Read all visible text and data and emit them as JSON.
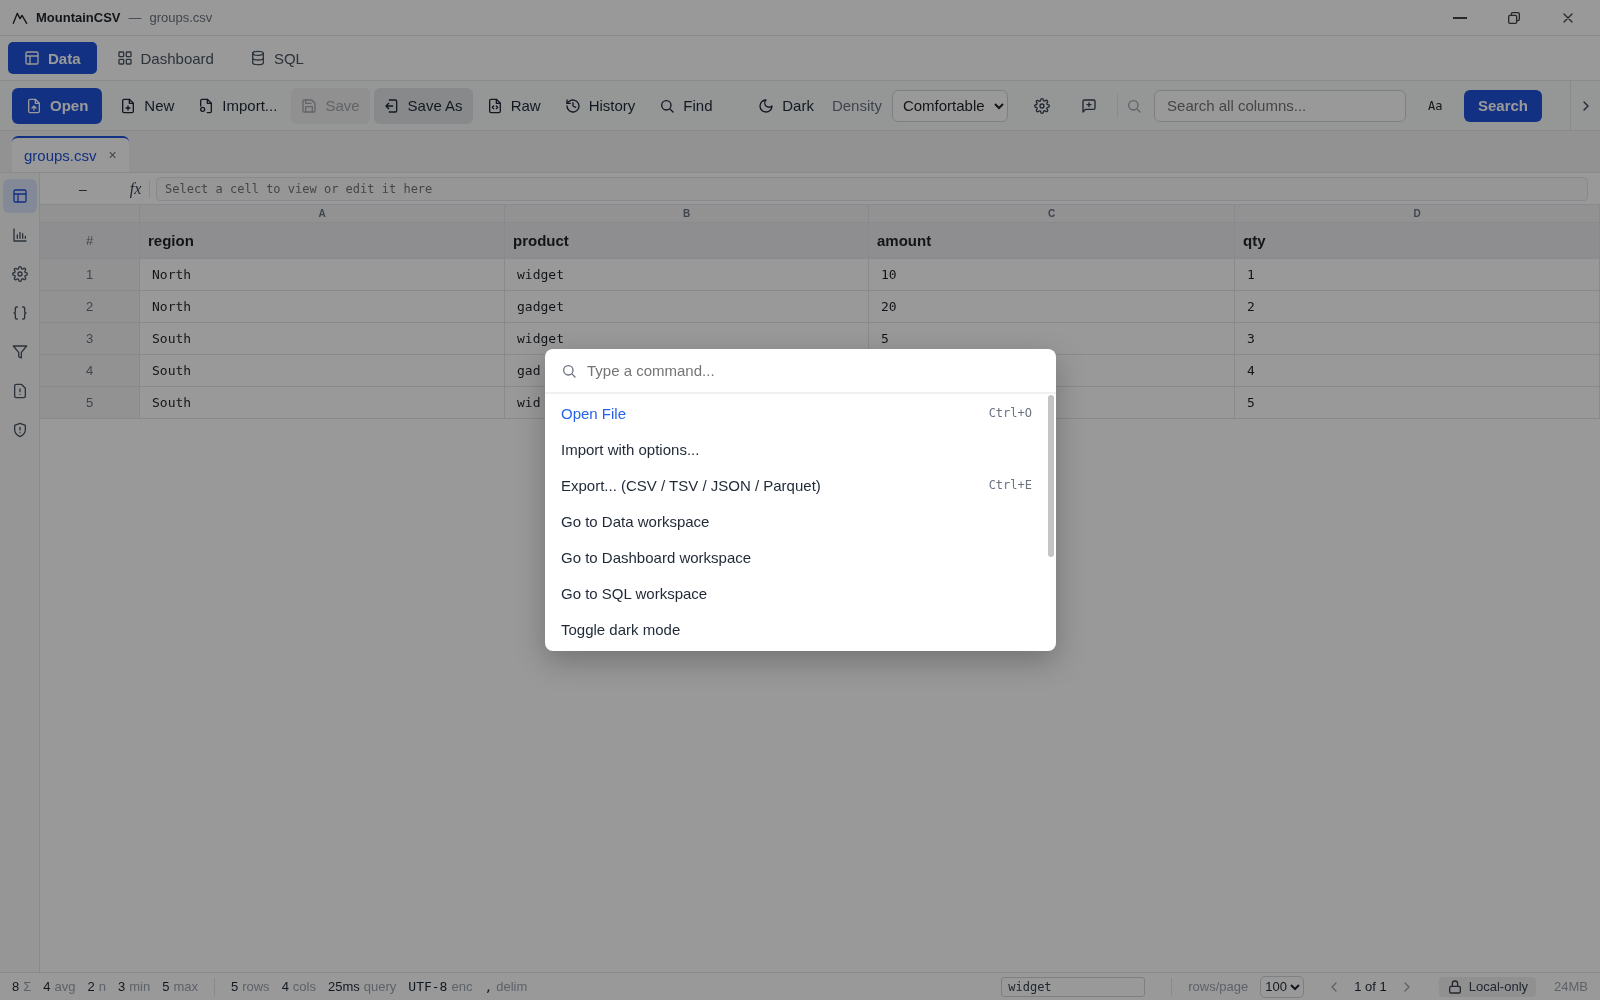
{
  "window": {
    "app_name": "MountainCSV",
    "separator": "—",
    "file_name": "groups.csv"
  },
  "workspace_tabs": [
    {
      "label": "Data",
      "selected": true
    },
    {
      "label": "Dashboard",
      "selected": false
    },
    {
      "label": "SQL",
      "selected": false
    }
  ],
  "toolbar": {
    "buttons": [
      {
        "label": "Open",
        "kind": "primary",
        "disabled": false
      },
      {
        "label": "New",
        "kind": "plain",
        "disabled": false
      },
      {
        "label": "Import...",
        "kind": "plain",
        "disabled": false
      },
      {
        "label": "Save",
        "kind": "plain",
        "disabled": true
      },
      {
        "label": "Save As",
        "kind": "shaded",
        "disabled": false
      },
      {
        "label": "Raw",
        "kind": "plain",
        "disabled": false
      },
      {
        "label": "History",
        "kind": "plain",
        "disabled": false
      },
      {
        "label": "Find",
        "kind": "plain",
        "disabled": false
      },
      {
        "label": "Dark",
        "kind": "plain",
        "disabled": false
      }
    ],
    "density_label": "Density",
    "density_value": "Comfortable",
    "search_placeholder": "Search all columns...",
    "case_toggle": "Aa",
    "search_button": "Search"
  },
  "file_tabs": [
    {
      "label": "groups.csv",
      "close": "×",
      "selected": true
    }
  ],
  "sidebar": {
    "items": [
      {
        "selected": true
      },
      {
        "selected": false
      },
      {
        "selected": false
      },
      {
        "selected": false
      },
      {
        "selected": false
      },
      {
        "selected": false
      },
      {
        "selected": false
      }
    ]
  },
  "formula_bar": {
    "cell_ref": "–",
    "fx": "fx",
    "placeholder": "Select a cell to view or edit it here"
  },
  "table": {
    "column_letters": [
      "A",
      "B",
      "C",
      "D"
    ],
    "row_header": "#",
    "columns": [
      "region",
      "product",
      "amount",
      "qty"
    ],
    "rows": [
      {
        "n": "1",
        "cells": {
          "region": "North",
          "product": "widget",
          "amount": "10",
          "qty": "1"
        }
      },
      {
        "n": "2",
        "cells": {
          "region": "North",
          "product": "gadget",
          "amount": "20",
          "qty": "2"
        }
      },
      {
        "n": "3",
        "cells": {
          "region": "South",
          "product": "widget",
          "amount": "5",
          "qty": "3"
        }
      },
      {
        "n": "4",
        "cells": {
          "region": "South",
          "product": "gad",
          "qty": "4"
        }
      },
      {
        "n": "5",
        "cells": {
          "region": "South",
          "product": "wid",
          "qty": "5"
        }
      }
    ]
  },
  "command_palette": {
    "placeholder": "Type a command...",
    "items": [
      {
        "label": "Open File",
        "shortcut": "Ctrl+O",
        "selected": true
      },
      {
        "label": "Import with options...",
        "selected": false
      },
      {
        "label": "Export... (CSV / TSV / JSON / Parquet)",
        "shortcut": "Ctrl+E",
        "selected": false
      },
      {
        "label": "Go to Data workspace",
        "selected": false
      },
      {
        "label": "Go to Dashboard workspace",
        "selected": false
      },
      {
        "label": "Go to SQL workspace",
        "selected": false
      },
      {
        "label": "Toggle dark mode",
        "selected": false
      }
    ]
  },
  "status_bar": {
    "stats": [
      {
        "figure": "8",
        "unit": "Σ"
      },
      {
        "figure": "4",
        "unit": "avg"
      },
      {
        "figure": "2",
        "unit": "n"
      },
      {
        "figure": "3",
        "unit": "min"
      },
      {
        "figure": "5",
        "unit": "max"
      }
    ],
    "info": [
      {
        "figure": "5",
        "unit": "rows"
      },
      {
        "figure": "4",
        "unit": "cols"
      },
      {
        "figure": "25ms",
        "unit": "query"
      },
      {
        "figure": "UTF-8",
        "unit": "enc"
      },
      {
        "figure": ",",
        "unit": "delim"
      }
    ],
    "filter_value": "widget",
    "rows_per_page_label": "rows/page",
    "rows_per_page": "100",
    "page": "1 of 1",
    "privacy": "Local-only",
    "memory": "24MB"
  }
}
